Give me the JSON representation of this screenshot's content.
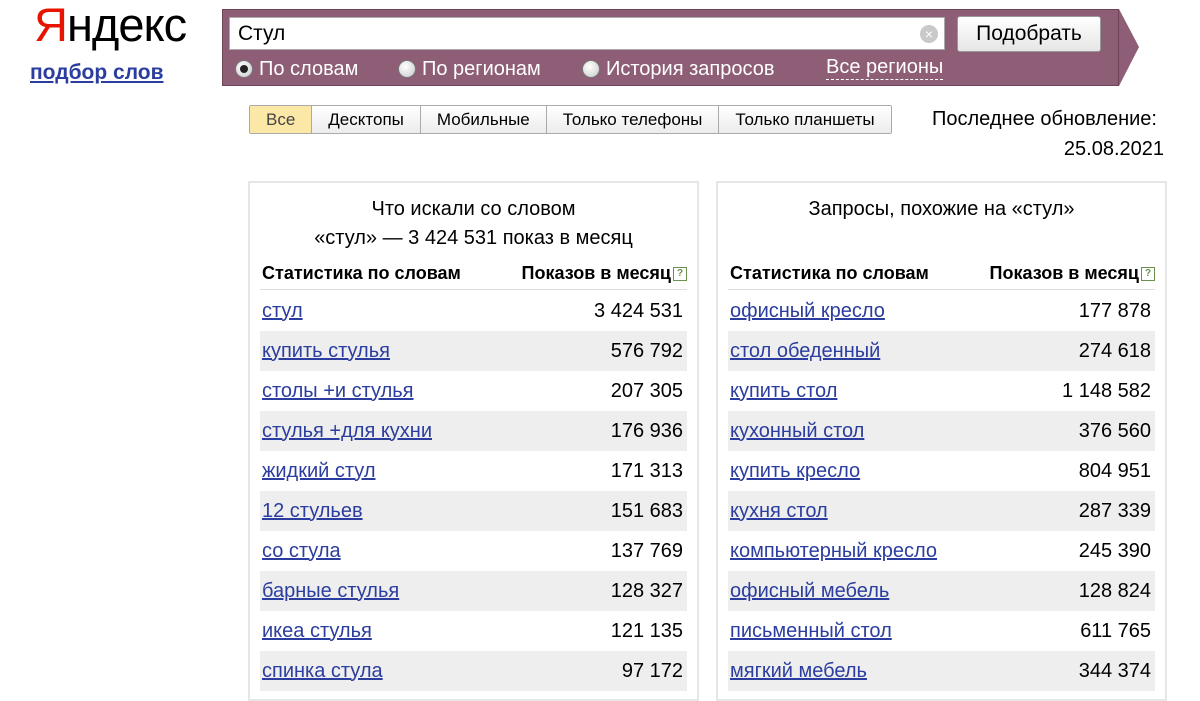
{
  "logo": {
    "first_letter": "Я",
    "rest": "ндекс"
  },
  "subtitle": "подбор слов",
  "search": {
    "value": "Стул",
    "clear_icon": "×",
    "submit_label": "Подобрать",
    "modes": [
      {
        "label": "По словам",
        "selected": true
      },
      {
        "label": "По регионам",
        "selected": false
      },
      {
        "label": "История запросов",
        "selected": false
      }
    ],
    "regions_link": "Все регионы"
  },
  "device_tabs": [
    {
      "label": "Все",
      "active": true
    },
    {
      "label": "Десктопы",
      "active": false
    },
    {
      "label": "Мобильные",
      "active": false
    },
    {
      "label": "Только телефоны",
      "active": false
    },
    {
      "label": "Только планшеты",
      "active": false
    }
  ],
  "last_update": {
    "label": "Последнее обновление:",
    "date": "25.08.2021"
  },
  "left_panel": {
    "title_line1": "Что искали со словом",
    "title_line2": "«стул» — 3 424 531 показ в месяц",
    "col_word": "Статистика по словам",
    "col_count": "Показов в месяц",
    "rows": [
      {
        "word": "стул",
        "count": "3 424 531"
      },
      {
        "word": "купить стулья",
        "count": "576 792"
      },
      {
        "word": "столы +и стулья",
        "count": "207 305"
      },
      {
        "word": "стулья +для кухни",
        "count": "176 936"
      },
      {
        "word": "жидкий стул",
        "count": "171 313"
      },
      {
        "word": "12 стульев",
        "count": "151 683"
      },
      {
        "word": "со стула",
        "count": "137 769"
      },
      {
        "word": "барные стулья",
        "count": "128 327"
      },
      {
        "word": "икеа стулья",
        "count": "121 135"
      },
      {
        "word": "спинка стула",
        "count": "97 172"
      }
    ]
  },
  "right_panel": {
    "title_line1": "Запросы, похожие на «стул»",
    "col_word": "Статистика по словам",
    "col_count": "Показов в месяц",
    "rows": [
      {
        "word": "офисный кресло",
        "count": "177 878"
      },
      {
        "word": "стол обеденный",
        "count": "274 618"
      },
      {
        "word": "купить стол",
        "count": "1 148 582"
      },
      {
        "word": "кухонный стол",
        "count": "376 560"
      },
      {
        "word": "купить кресло",
        "count": "804 951"
      },
      {
        "word": "кухня стол",
        "count": "287 339"
      },
      {
        "word": "компьютерный кресло",
        "count": "245 390"
      },
      {
        "word": "офисный мебель",
        "count": "128 824"
      },
      {
        "word": "письменный стол",
        "count": "611 765"
      },
      {
        "word": "мягкий мебель",
        "count": "344 374"
      }
    ]
  },
  "help_icon": "?"
}
